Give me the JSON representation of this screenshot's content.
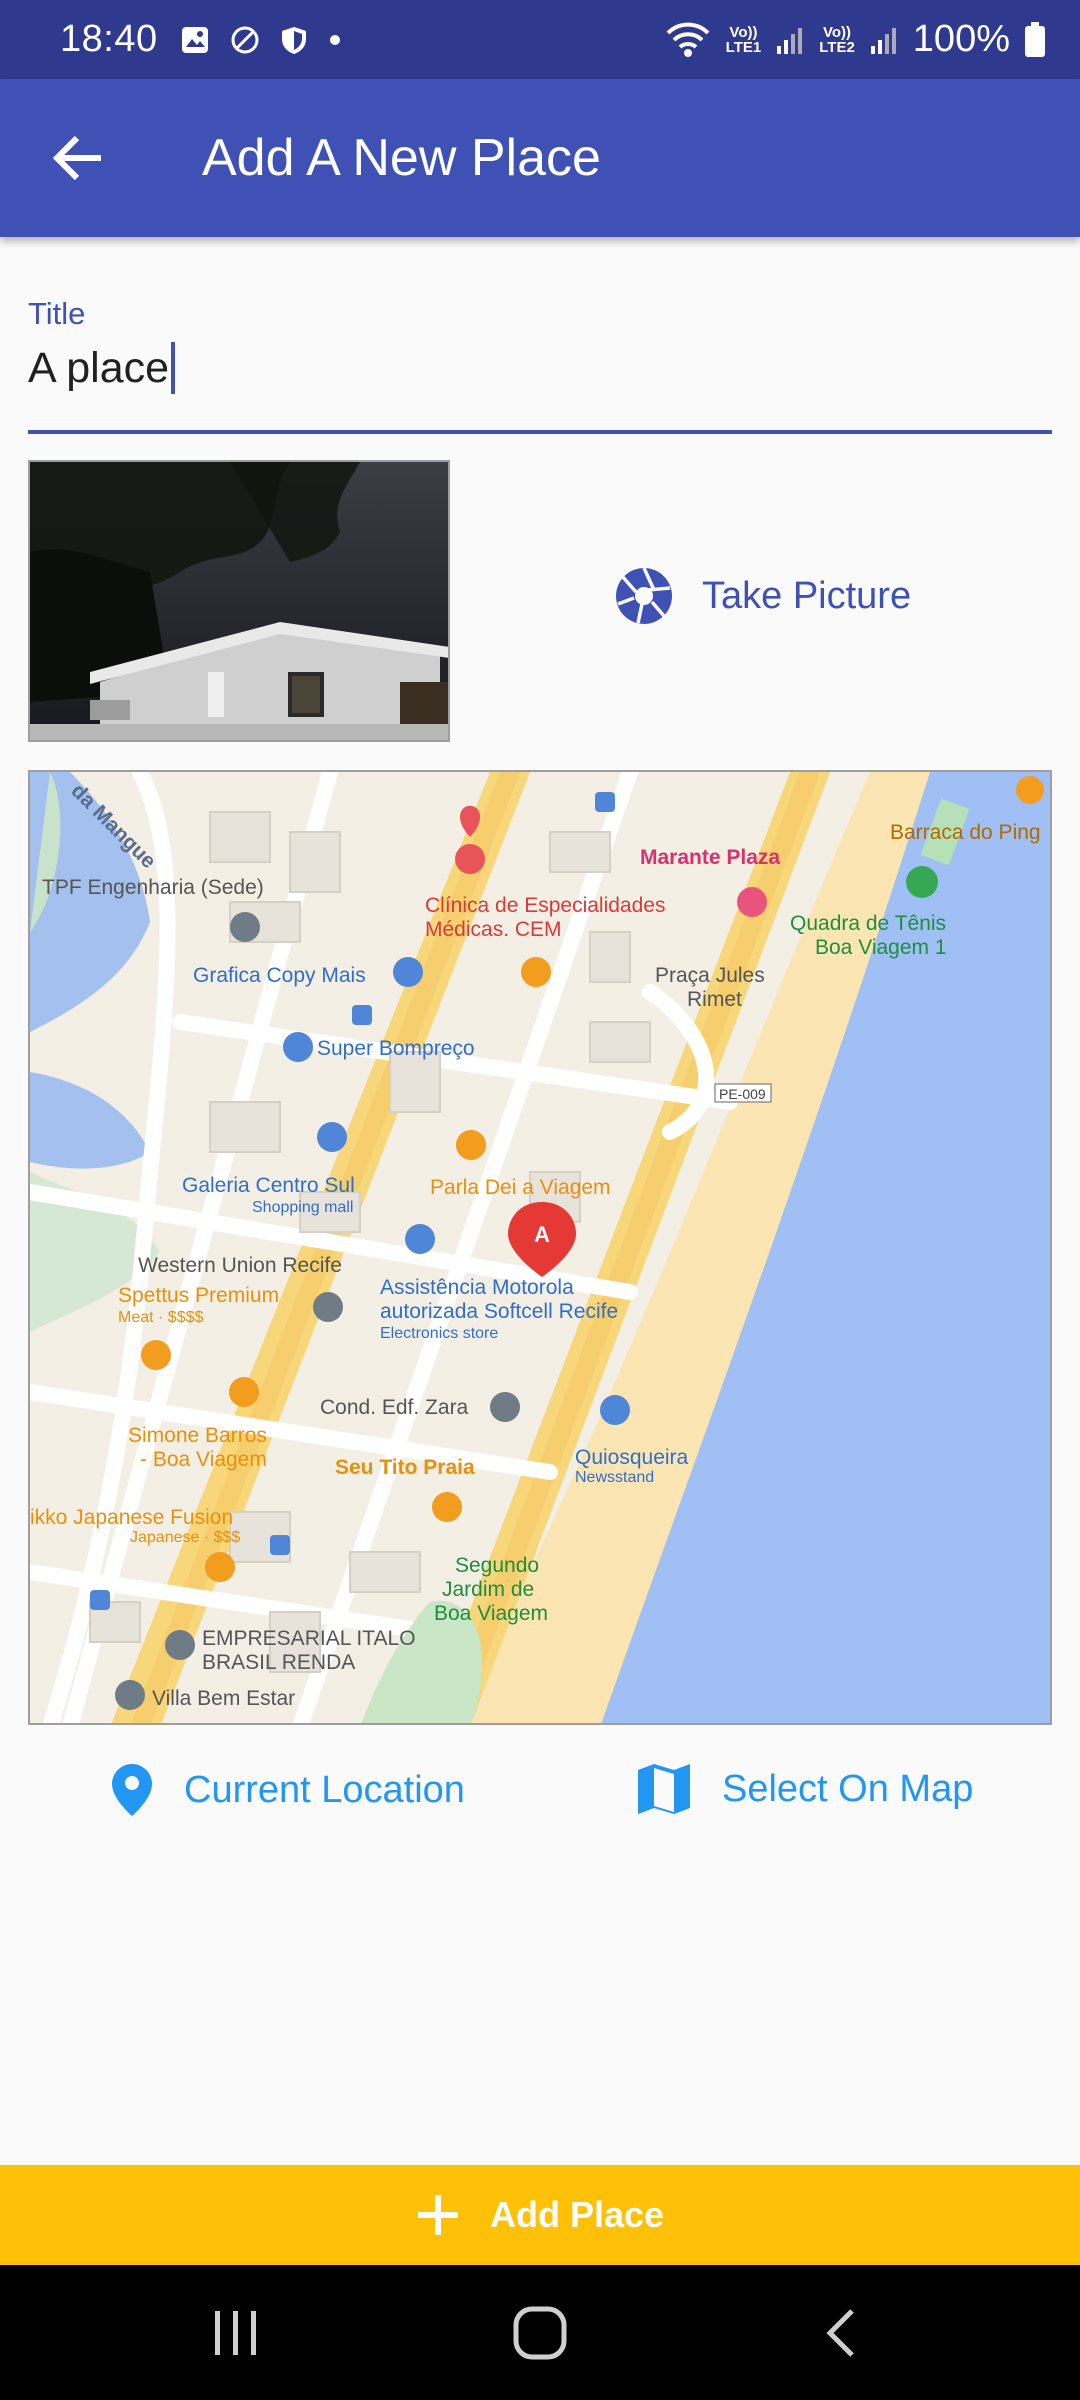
{
  "status_bar": {
    "time": "18:40",
    "lte1": "LTE1",
    "lte2": "LTE2",
    "vo1": "Vo))",
    "vo2": "Vo))",
    "battery": "100%"
  },
  "app_bar": {
    "title": "Add A New Place",
    "back_icon": "arrow-back-icon"
  },
  "title_field": {
    "label": "Title",
    "value": "A place"
  },
  "image_preview": {
    "take_picture_label": "Take Picture",
    "icon": "camera-shutter-icon"
  },
  "map": {
    "marker_label": "A",
    "labels": {
      "mangue": "da Mangue",
      "tpf": "TPF Engenharia (Sede)",
      "clinica1": "Clínica de Especialidades",
      "clinica2": "Médicas. CEM",
      "marante": "Marante Plaza",
      "barraca": "Barraca do Ping",
      "quadra1": "Quadra de Tênis",
      "quadra2": "Boa Viagem 1",
      "grafica": "Grafica Copy Mais",
      "praca1": "Praça Jules",
      "praca2": "Rimet",
      "super": "Super Bompreço",
      "pe009": "PE-009",
      "galeria": "Galeria Centro Sul",
      "galeria_sub": "Shopping mall",
      "parla": "Parla Dei   a Viagem",
      "western": "Western Union Recife",
      "assist1": "Assistência Motorola",
      "assist2": "autorizada Softcell Recife",
      "assist_sub": "Electronics store",
      "spettus": "Spettus Premium",
      "spettus_sub": "Meat · $$$$",
      "cond": "Cond. Edf. Zara",
      "simone1": "Simone Barros",
      "simone2": "- Boa Viagem",
      "seu_tito": "Seu Tito Praia",
      "quiosq": "Quiosqueira",
      "quiosq_sub": "Newsstand",
      "ikko": "ikko Japanese Fusion",
      "ikko_sub": "Japanese · $$$",
      "segundo1": "Segundo",
      "segundo2": "Jardim de",
      "segundo3": "Boa Viagem",
      "empresarial1": "EMPRESARIAL ITALO",
      "empresarial2": "BRASIL RENDA",
      "villa": "Villa Bem Estar"
    }
  },
  "location_buttons": {
    "current": "Current Location",
    "current_icon": "location-pin-icon",
    "select": "Select On Map",
    "select_icon": "map-icon"
  },
  "add_button": {
    "label": "Add Place",
    "icon": "plus-icon"
  },
  "colors": {
    "primary": "#3f51b5",
    "primary_dark": "#2f3a8f",
    "accent": "#ffc107",
    "link_blue": "#2196f3"
  }
}
